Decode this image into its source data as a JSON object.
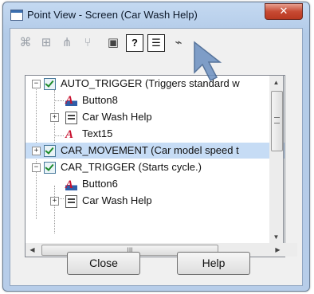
{
  "window": {
    "title": "Point View - Screen (Car Wash Help)"
  },
  "toolbar": {
    "buttons": [
      {
        "icon": "properties-icon",
        "glyph": "⌘"
      },
      {
        "icon": "tree-icon",
        "glyph": "⌥"
      },
      {
        "icon": "network-icon",
        "glyph": "✉"
      },
      {
        "icon": "branch-icon",
        "glyph": "⌖"
      },
      {
        "icon": "copy-icon",
        "glyph": "▣"
      },
      {
        "icon": "help-icon",
        "glyph": "?"
      },
      {
        "icon": "list-icon",
        "glyph": "☰"
      },
      {
        "icon": "chart-icon",
        "glyph": "⌁"
      }
    ]
  },
  "tree": {
    "nodes": [
      {
        "label": "AUTO_TRIGGER (Triggers standard w",
        "icon": "checkbox-checked",
        "selected": false
      },
      {
        "label": "Button8",
        "icon": "button-object-icon",
        "selected": false
      },
      {
        "label": "Car Wash Help",
        "icon": "screen-icon",
        "selected": false
      },
      {
        "label": "Text15",
        "icon": "text-object-icon",
        "selected": false
      },
      {
        "label": "CAR_MOVEMENT (Car model speed t",
        "icon": "checkbox-checked",
        "selected": true
      },
      {
        "label": "CAR_TRIGGER (Starts cycle.)",
        "icon": "checkbox-checked",
        "selected": false
      },
      {
        "label": "Button6",
        "icon": "button-object-icon",
        "selected": false
      },
      {
        "label": "Car Wash Help",
        "icon": "screen-icon",
        "selected": false
      }
    ]
  },
  "buttons": {
    "close": "Close",
    "help": "Help"
  },
  "colors": {
    "selection": "#c6dcf5",
    "title_bar": "#b3cbe8",
    "close_button": "#c74a33"
  }
}
